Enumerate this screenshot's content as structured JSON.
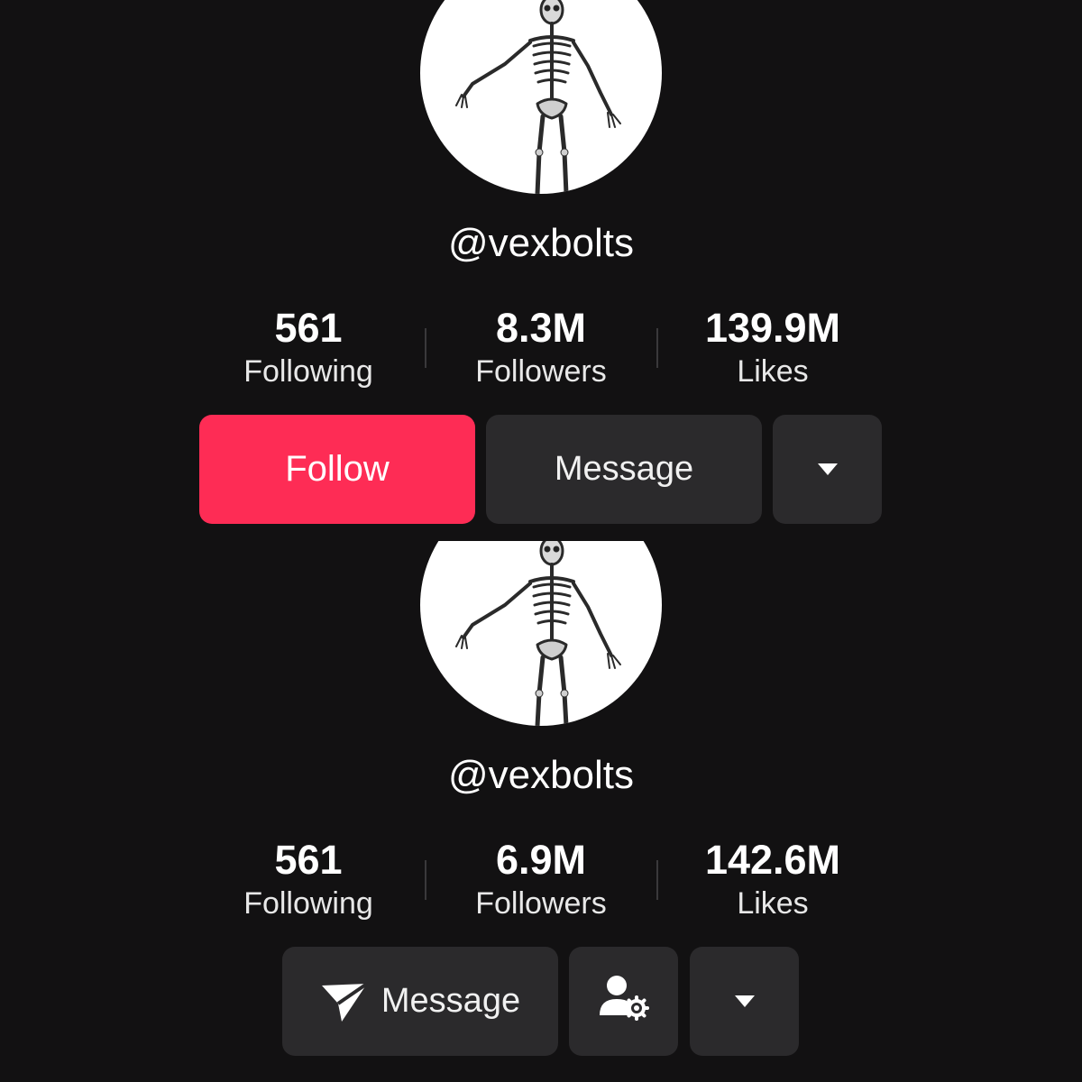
{
  "profile_before": {
    "username": "@vexbolts",
    "stats": [
      {
        "value": "561",
        "label": "Following"
      },
      {
        "value": "8.3M",
        "label": "Followers"
      },
      {
        "value": "139.9M",
        "label": "Likes"
      }
    ],
    "follow_label": "Follow",
    "message_label": "Message",
    "more_icon": "caret-down-icon"
  },
  "profile_after": {
    "username": "@vexbolts",
    "stats": [
      {
        "value": "561",
        "label": "Following"
      },
      {
        "value": "6.9M",
        "label": "Followers"
      },
      {
        "value": "142.6M",
        "label": "Likes"
      }
    ],
    "message_label": "Message",
    "message_icon": "send-icon",
    "friend_icon": "user-settings-icon",
    "more_icon": "caret-down-icon"
  },
  "colors": {
    "background": "#121112",
    "follow_button": "#fe2c55",
    "secondary_button": "#2b2a2c"
  }
}
